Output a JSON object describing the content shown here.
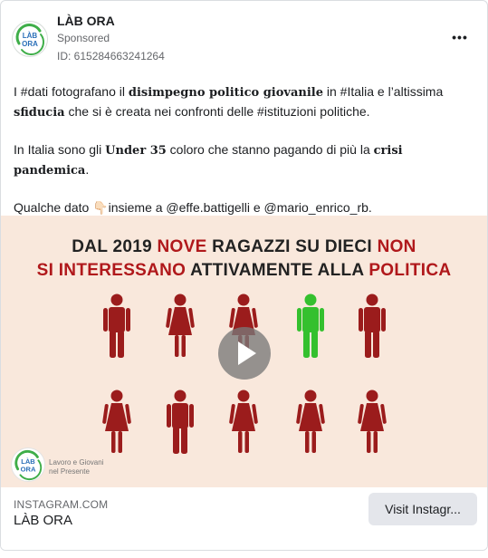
{
  "post": {
    "page_name": "LÀB ORA",
    "sponsored": "Sponsored",
    "ad_id": "ID: 615284663241264",
    "more_label": "•••",
    "avatar_logo_text_top": "LÀB",
    "avatar_logo_text_bottom": "ORA"
  },
  "body": {
    "p1_a": "I #dati fotografano il ",
    "p1_b": "disimpegno politico giovanile",
    "p1_c": " in #Italia e l’altissima ",
    "p1_d": "sfiducia",
    "p1_e": " che si è creata nei confronti delle #istituzioni politiche.",
    "p2_a": "In Italia sono gli ",
    "p2_b": "Under 35",
    "p2_c": " coloro che stanno pagando di più la ",
    "p2_d": "crisi pandemica",
    "p2_e": ".",
    "p3_a": "Qualche dato ",
    "p3_emoji": "👇🏻",
    "p3_b": "insieme a @effe.battigelli e @mario_enrico_rb.",
    "ellipsis": "..."
  },
  "media": {
    "headline_l1_a": "DAL 2019 ",
    "headline_l1_b": "NOVE",
    "headline_l1_c": " RAGAZZI SU DIECI ",
    "headline_l1_d": "NON",
    "headline_l2_a": "SI INTERESSANO",
    "headline_l2_b": " ATTIVAMENTE ALLA ",
    "headline_l2_c": "POLITICA",
    "figures_total": 10,
    "figures_engaged": 1,
    "watermark_logo_top": "LÀB",
    "watermark_logo_bottom": "ORA",
    "watermark_line1": "Lavoro e Giovani",
    "watermark_line2": "nel Presente",
    "colors": {
      "accent_red": "#b0181b",
      "figure_red": "#9b1c1c",
      "figure_green": "#34c02e",
      "background": "#f9e8dc",
      "brand_green": "#3fae49",
      "brand_blue": "#2a6fb8"
    }
  },
  "footer": {
    "domain": "INSTAGRAM.COM",
    "title": "LÀB ORA",
    "cta_label": "Visit Instagr..."
  },
  "icons": [
    "more-icon",
    "play-icon",
    "avatar-logo",
    "watermark-logo",
    "person-icon"
  ]
}
